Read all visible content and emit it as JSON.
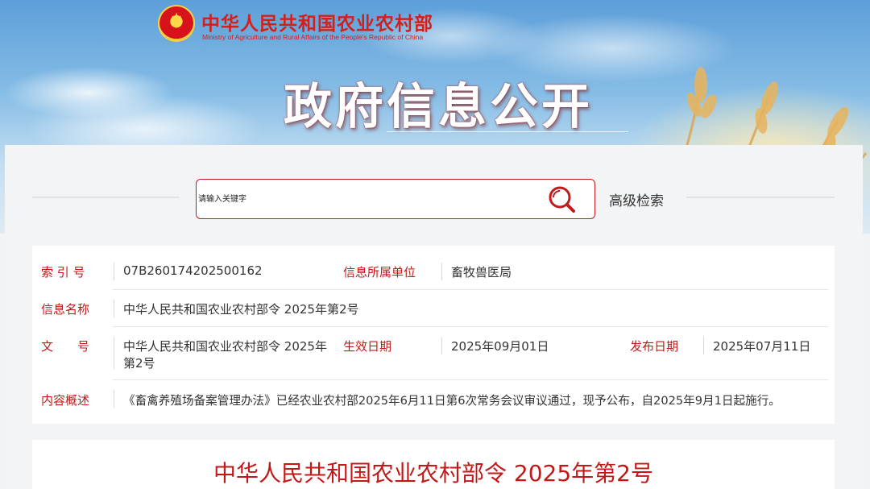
{
  "header": {
    "ministry_cn": "中华人民共和国农业农村部",
    "ministry_en": "Ministry of Agriculture and Rural Affairs of the People's Republic of China",
    "site_title": "政府信息公开"
  },
  "search": {
    "placeholder": "请输入关键字",
    "advanced_label": "高级检索"
  },
  "meta": {
    "index_label": "索 引 号",
    "index_value": "07B260174202500162",
    "unit_label": "信息所属单位",
    "unit_value": "畜牧兽医局",
    "name_label": "信息名称",
    "name_value": "中华人民共和国农业农村部令 2025年第2号",
    "docno_label": "文　　号",
    "docno_value_line1": "中华人民共和国农业农村部令 2025年",
    "docno_value_line2": "第2号",
    "effective_label": "生效日期",
    "effective_value": "2025年09月01日",
    "publish_label": "发布日期",
    "publish_value": "2025年07月11日",
    "summary_label": "内容概述",
    "summary_value": "《畜禽养殖场备案管理办法》已经农业农村部2025年6月11日第6次常务会议审议通过，现予公布，自2025年9月1日起施行。"
  },
  "document": {
    "title": "中华人民共和国农业农村部令 2025年第2号"
  },
  "colors": {
    "accent_red": "#c41818",
    "sky_blue": "#5d9fd9"
  }
}
